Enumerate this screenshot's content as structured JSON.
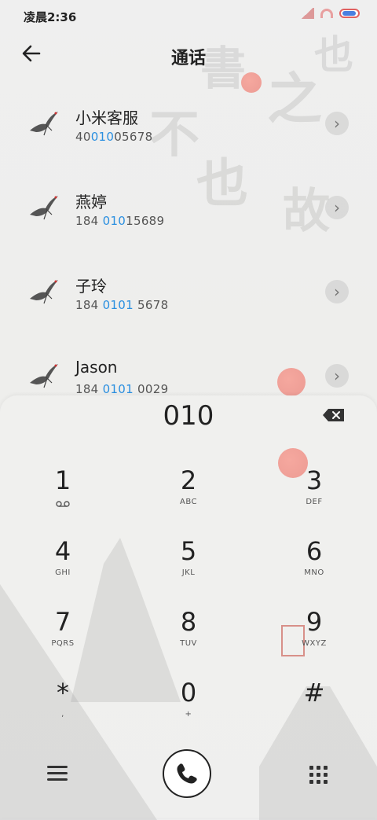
{
  "status": {
    "time": "凌晨2:36"
  },
  "header": {
    "title": "通话"
  },
  "contacts": [
    {
      "name": "小米客服",
      "num_pre": "40",
      "num_hl": "010",
      "num_post": "05678"
    },
    {
      "name": "燕婷",
      "num_pre": "184 ",
      "num_hl": "010",
      "num_post": "15689"
    },
    {
      "name": "子玲",
      "num_pre": "184 ",
      "num_hl": "0101",
      "num_post": " 5678"
    },
    {
      "name": "Jason",
      "num_pre": "184 ",
      "num_hl": "0101",
      "num_post": " 0029"
    }
  ],
  "dialer": {
    "input": "010",
    "keys": [
      {
        "digit": "1",
        "letters": ""
      },
      {
        "digit": "2",
        "letters": "ABC"
      },
      {
        "digit": "3",
        "letters": "DEF"
      },
      {
        "digit": "4",
        "letters": "GHI"
      },
      {
        "digit": "5",
        "letters": "JKL"
      },
      {
        "digit": "6",
        "letters": "MNO"
      },
      {
        "digit": "7",
        "letters": "PQRS"
      },
      {
        "digit": "8",
        "letters": "TUV"
      },
      {
        "digit": "9",
        "letters": "WXYZ"
      },
      {
        "digit": "*",
        "letters": ","
      },
      {
        "digit": "0",
        "letters": "+"
      },
      {
        "digit": "#",
        "letters": ""
      }
    ]
  },
  "colors": {
    "highlight": "#2a8fe0",
    "accent_sun": "#eb786e"
  }
}
